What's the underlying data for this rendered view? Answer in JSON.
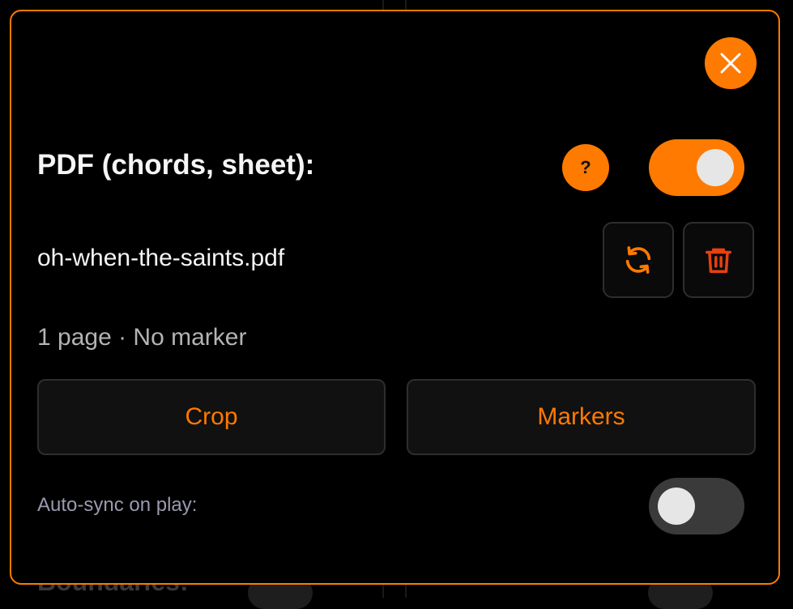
{
  "modal": {
    "title": "PDF (chords, sheet):",
    "help_label": "?",
    "pdf_enabled": true,
    "file": {
      "name": "oh-when-the-saints.pdf",
      "meta": "1 page · No marker"
    },
    "actions": {
      "crop_label": "Crop",
      "markers_label": "Markers"
    },
    "auto_sync": {
      "label": "Auto-sync on play:",
      "enabled": false
    }
  },
  "background": {
    "partial_heading": "Boundaries:"
  },
  "icons": {
    "close": "close-icon",
    "help": "question-icon",
    "refresh": "refresh-icon",
    "delete": "trash-icon"
  },
  "colors": {
    "accent": "#ff7a00",
    "danger": "#e8410f",
    "background": "#000000"
  }
}
